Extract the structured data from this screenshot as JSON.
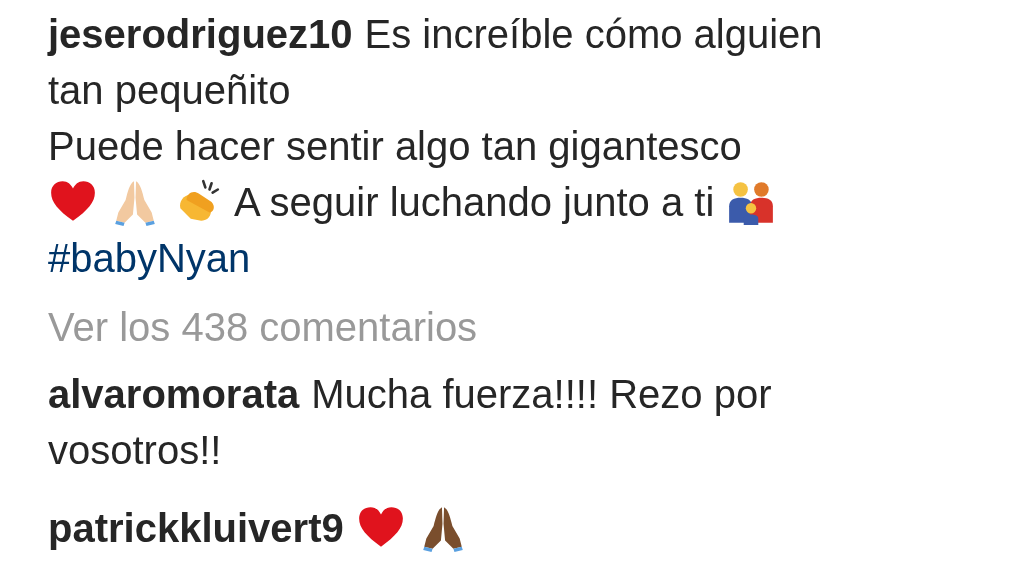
{
  "caption": {
    "username": "jeserodriguez10",
    "lines": [
      [
        {
          "kind": "text",
          "text": "Es increíble cómo alguien"
        }
      ],
      [
        {
          "kind": "text",
          "text": "tan pequeñito"
        }
      ],
      [
        {
          "kind": "text",
          "text": "Puede hacer sentir algo tan gigantesco"
        }
      ],
      [
        {
          "kind": "heart"
        },
        {
          "kind": "praying-hands",
          "color": "#f2c9a0"
        },
        {
          "kind": "clapping-hands"
        },
        {
          "kind": "text",
          "text": "A seguir luchando junto a ti"
        },
        {
          "kind": "family"
        }
      ],
      [
        {
          "kind": "hashtag",
          "text": "#babyNyan"
        }
      ]
    ]
  },
  "view_all_link": "Ver los 438 comentarios",
  "comments": [
    {
      "username": "alvaromorata",
      "lines": [
        [
          {
            "kind": "text",
            "text": "Mucha fuerza!!!! Rezo por"
          }
        ],
        [
          {
            "kind": "text",
            "text": "vosotros!!"
          }
        ]
      ]
    },
    {
      "username": "patrickkluivert9",
      "lines": [
        [
          {
            "kind": "heart"
          },
          {
            "kind": "praying-hands",
            "color": "#7a4e2d"
          }
        ]
      ]
    }
  ]
}
